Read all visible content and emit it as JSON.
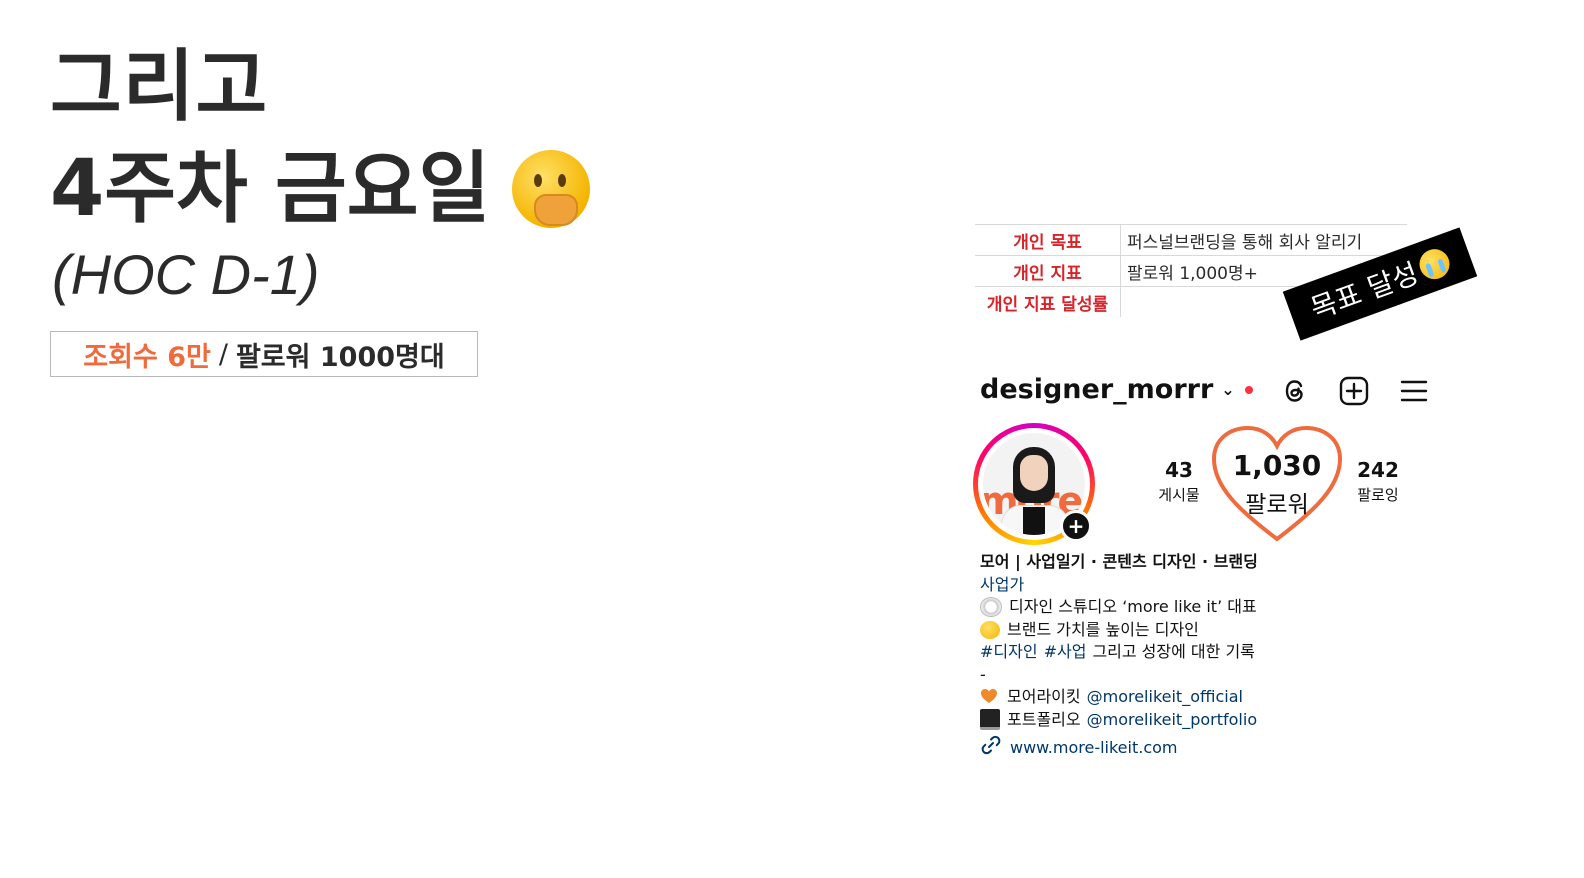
{
  "headline": {
    "line1": "그리고",
    "line2": "4주차 금요일",
    "emoji": "face-with-hand-over-mouth",
    "subtitle": "(HOC D-1)"
  },
  "stats": {
    "views": "조회수 6만",
    "separator": "/",
    "followers": "팔로워 1000명대"
  },
  "goals": {
    "rows": [
      {
        "key": "개인 목표",
        "value": "퍼스널브랜딩을 통해 회사 알리기"
      },
      {
        "key": "개인 지표",
        "value": "팔로워 1,000명+"
      },
      {
        "key": "개인 지표 달성률",
        "value": ""
      }
    ],
    "sticker": "목표 달성",
    "sticker_emoji": "loudly-crying-face"
  },
  "profile": {
    "username": "designer_morrr",
    "avatar_text": "more",
    "counts": {
      "posts": {
        "num": "43",
        "label": "게시물"
      },
      "followers": {
        "num": "1,030",
        "label": "팔로워"
      },
      "following": {
        "num": "242",
        "label": "팔로잉"
      }
    },
    "bio": {
      "name": "모어 | 사업일기 · 콘텐츠 디자인 · 브랜딩",
      "category": "사업가",
      "line1": "디자인 스튜디오 ‘more like it’ 대표",
      "line2": "브랜드 가치를 높이는 디자인",
      "tag1": "#디자인",
      "tag2": "#사업",
      "line3_rest": "그리고 성장에 대한 기록",
      "dash": "-",
      "brand_label": "모어라이킷",
      "brand_mention": "@morelikeit_official",
      "portfolio_label": "포트폴리오",
      "portfolio_mention": "@morelikeit_portfolio",
      "website": "www.more-likeit.com"
    }
  },
  "colors": {
    "accent_orange": "#ef6a3c",
    "goal_red": "#d8232a",
    "link_blue": "#00376b",
    "heart_stroke": "#ef6a3c"
  }
}
